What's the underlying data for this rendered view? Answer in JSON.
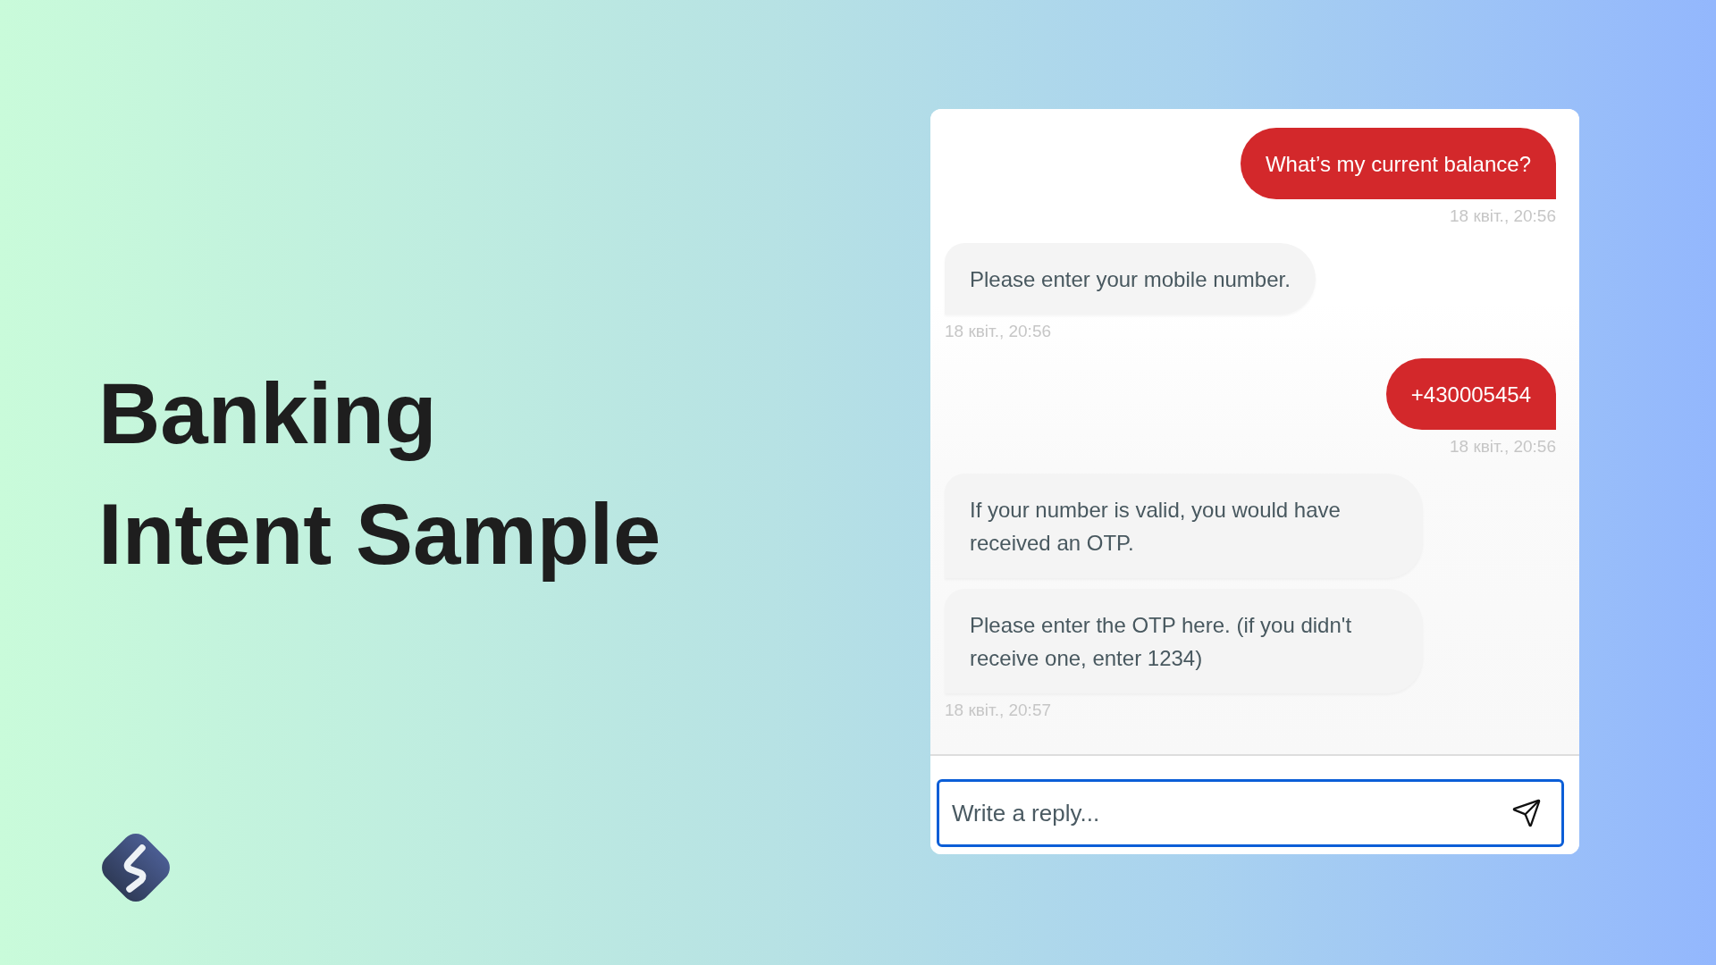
{
  "title": "Banking Intent Sample",
  "chat": {
    "messages": [
      {
        "kind": "user",
        "text": "What’s my current balance?",
        "time": "18 квіт., 20:56"
      },
      {
        "kind": "bot",
        "text": "Please enter your mobile number.",
        "time": "18 квіт., 20:56"
      },
      {
        "kind": "user",
        "text": "+430005454",
        "time": "18 квіт., 20:56"
      },
      {
        "kind": "bot",
        "text": "If your number is valid, you would have received an OTP."
      },
      {
        "kind": "bot",
        "text": "Please enter the OTP here. (if you didn't receive one, enter 1234)",
        "time": "18 квіт., 20:57"
      }
    ],
    "reply": {
      "placeholder": "Write a reply..."
    }
  }
}
